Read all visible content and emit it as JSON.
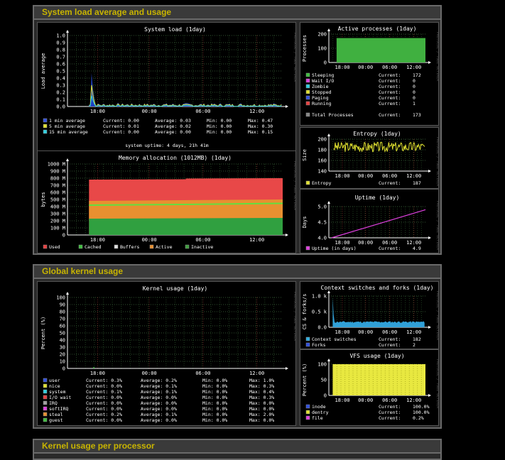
{
  "sections": {
    "load": "System load average and usage",
    "kernel": "Global kernel usage",
    "per_processor": "Kernel usage per processor"
  },
  "watermark": "PROTOCOL / TOBI OETIKER",
  "colors": {
    "bg": "#000000",
    "grid": "#3a5a3a",
    "text": "#ffffff",
    "accent": "#c8b400"
  },
  "charts": {
    "sysload": {
      "title": "System load  (1day)",
      "ylabel": "Load average",
      "xticks": [
        "18:00",
        "00:00",
        "06:00",
        "12:00"
      ],
      "yticks": [
        "1.0",
        "0.9",
        "0.8",
        "0.7",
        "0.6",
        "0.5",
        "0.4",
        "0.3",
        "0.2",
        "0.1",
        "0.0"
      ],
      "legend": [
        {
          "label": "1 min average",
          "cur": "Current:  0.00",
          "avg": "Average:  0.03",
          "min": "Min:  0.00",
          "max": "Max:  0.47",
          "color": "#3050e0"
        },
        {
          "label": "5 min average",
          "cur": "Current:  0.01",
          "avg": "Average:  0.02",
          "min": "Min:  0.00",
          "max": "Max:  0.30",
          "color": "#e0e030"
        },
        {
          "label": "15 min average",
          "cur": "Current:  0.00",
          "avg": "Average:  0.00",
          "min": "Min:  0.00",
          "max": "Max:  0.15",
          "color": "#30d0e0"
        }
      ],
      "footer": "system uptime: 4 days, 21h 41m"
    },
    "memory": {
      "title": "Memory allocation (1012MB)  (1day)",
      "ylabel": "bytes",
      "xticks": [
        "18:00",
        "00:00",
        "06:00",
        "12:00"
      ],
      "yticks": [
        "1000 M",
        "900 M",
        "800 M",
        "700 M",
        "600 M",
        "500 M",
        "400 M",
        "300 M",
        "200 M",
        "100 M",
        "0"
      ],
      "legend": [
        {
          "label": "Used",
          "color": "#e84040"
        },
        {
          "label": "Cached",
          "color": "#40c040"
        },
        {
          "label": "Buffers",
          "color": "#e0e0e0"
        },
        {
          "label": "Active",
          "color": "#e89030"
        },
        {
          "label": "Inactive",
          "color": "#40a040"
        }
      ]
    },
    "procs": {
      "title": "Active processes  (1day)",
      "ylabel": "Processes",
      "xticks": [
        "18:00",
        "00:00",
        "06:00",
        "12:00"
      ],
      "yticks": [
        "200",
        "100",
        "0"
      ],
      "legend": [
        {
          "label": "Sleeping",
          "cur": "Current:",
          "val": "172",
          "color": "#40c040"
        },
        {
          "label": "Wait I/O",
          "cur": "Current:",
          "val": "0",
          "color": "#e040e0"
        },
        {
          "label": "Zombie",
          "cur": "Current:",
          "val": "0",
          "color": "#30d0e0"
        },
        {
          "label": "Stopped",
          "cur": "Current:",
          "val": "0",
          "color": "#e0e030"
        },
        {
          "label": "Paging",
          "cur": "Current:",
          "val": "0",
          "color": "#3050e0"
        },
        {
          "label": "Running",
          "cur": "Current:",
          "val": "1",
          "color": "#e84040"
        }
      ],
      "total": {
        "label": "Total Processes",
        "cur": "Current:",
        "val": "173",
        "color": "#888888"
      }
    },
    "entropy": {
      "title": "Entropy  (1day)",
      "ylabel": "Size",
      "xticks": [
        "18:00",
        "00:00",
        "06:00",
        "12:00"
      ],
      "yticks": [
        "200",
        "180",
        "160",
        "140"
      ],
      "legend": {
        "label": "Entropy",
        "cur": "Current:",
        "val": "187",
        "color": "#e0e030"
      }
    },
    "uptime": {
      "title": "Uptime  (1day)",
      "ylabel": "Days",
      "xticks": [
        "18:00",
        "00:00",
        "06:00",
        "12:00"
      ],
      "yticks": [
        "5.0",
        "4.5",
        "4.0"
      ],
      "legend": {
        "label": "Uptime  (in days)",
        "cur": "Current:",
        "val": "4.9",
        "color": "#e040e0"
      }
    },
    "kernel": {
      "title": "Kernel usage  (1day)",
      "ylabel": "Percent (%)",
      "xticks": [
        "18:00",
        "00:00",
        "06:00",
        "12:00"
      ],
      "yticks": [
        "100",
        "90",
        "80",
        "70",
        "60",
        "50",
        "40",
        "30",
        "20",
        "10",
        "0"
      ],
      "legend": [
        {
          "label": "user",
          "cur": "Current:  0.3%",
          "avg": "Average:  0.2%",
          "min": "Min:  0.0%",
          "max": "Max:  1.0%",
          "color": "#3050e0"
        },
        {
          "label": "nice",
          "cur": "Current:  0.0%",
          "avg": "Average:  0.1%",
          "min": "Min:  0.0%",
          "max": "Max:  0.3%",
          "color": "#e0e030"
        },
        {
          "label": "system",
          "cur": "Current:  0.1%",
          "avg": "Average:  0.1%",
          "min": "Min:  0.0%",
          "max": "Max:  0.4%",
          "color": "#30d0e0"
        },
        {
          "label": "I/O wait",
          "cur": "Current:  0.0%",
          "avg": "Average:  0.0%",
          "min": "Min:  0.0%",
          "max": "Max:  0.3%",
          "color": "#e84040"
        },
        {
          "label": "IRQ",
          "cur": "Current:  0.0%",
          "avg": "Average:  0.0%",
          "min": "Min:  0.0%",
          "max": "Max:  0.0%",
          "color": "#a0a0a0"
        },
        {
          "label": "softIRQ",
          "cur": "Current:  0.0%",
          "avg": "Average:  0.0%",
          "min": "Min:  0.0%",
          "max": "Max:  0.0%",
          "color": "#e040e0"
        },
        {
          "label": "steal",
          "cur": "Current:  0.2%",
          "avg": "Average:  0.1%",
          "min": "Min:  0.0%",
          "max": "Max:  2.0%",
          "color": "#e89030"
        },
        {
          "label": "guest",
          "cur": "Current:  0.0%",
          "avg": "Average:  0.0%",
          "min": "Min:  0.0%",
          "max": "Max:  0.0%",
          "color": "#40c040"
        }
      ]
    },
    "context": {
      "title": "Context switches and forks  (1day)",
      "ylabel": "CS & forks/s",
      "xticks": [
        "18:00",
        "00:00",
        "06:00",
        "12:00"
      ],
      "yticks": [
        "1.0 k",
        "0.5 k",
        "0.0"
      ],
      "legend": [
        {
          "label": "Context switches",
          "cur": "Current:",
          "val": "182",
          "color": "#30b0e0"
        },
        {
          "label": "Forks",
          "cur": "Current:",
          "val": "2",
          "color": "#3050e0"
        }
      ]
    },
    "vfs": {
      "title": "VFS usage  (1day)",
      "ylabel": "Percent (%)",
      "xticks": [
        "18:00",
        "00:00",
        "06:00",
        "12:00"
      ],
      "yticks": [
        "100",
        "50",
        "0"
      ],
      "legend": [
        {
          "label": "inode",
          "cur": "Current:",
          "val": "100.0%",
          "color": "#3050e0"
        },
        {
          "label": "dentry",
          "cur": "Current:",
          "val": "100.0%",
          "color": "#e0e030"
        },
        {
          "label": "file",
          "cur": "Current:",
          "val": "0.2%",
          "color": "#e040e0"
        }
      ]
    }
  },
  "chart_data": [
    {
      "type": "line",
      "title": "System load  (1day)",
      "ylabel": "Load average",
      "ylim": [
        0,
        1.0
      ],
      "series": [
        {
          "name": "1 min average",
          "peak": 0.47
        },
        {
          "name": "5 min average",
          "peak": 0.3
        },
        {
          "name": "15 min average",
          "peak": 0.15
        }
      ]
    },
    {
      "type": "area",
      "title": "Memory allocation (1012MB)  (1day)",
      "ylabel": "bytes",
      "ylim": [
        0,
        1000
      ],
      "series": [
        {
          "name": "Used",
          "values": [
            780,
            780,
            790,
            800
          ]
        },
        {
          "name": "Active",
          "values": [
            410,
            410,
            420,
            430
          ]
        },
        {
          "name": "Inactive",
          "values": [
            200,
            200,
            200,
            210
          ]
        }
      ]
    },
    {
      "type": "area",
      "title": "Active processes  (1day)",
      "ylabel": "Processes",
      "ylim": [
        0,
        200
      ],
      "series": [
        {
          "name": "Sleeping",
          "values": [
            172,
            172,
            172,
            172
          ]
        }
      ]
    },
    {
      "type": "line",
      "title": "Entropy  (1day)",
      "ylabel": "Size",
      "ylim": [
        130,
        200
      ],
      "series": [
        {
          "name": "Entropy",
          "values": [
            180,
            185,
            175,
            187
          ]
        }
      ]
    },
    {
      "type": "line",
      "title": "Uptime  (1day)",
      "ylabel": "Days",
      "ylim": [
        4.0,
        5.0
      ],
      "series": [
        {
          "name": "Uptime  (in days)",
          "values": [
            4.0,
            4.9
          ]
        }
      ]
    },
    {
      "type": "area",
      "title": "Kernel usage  (1day)",
      "ylabel": "Percent (%)",
      "ylim": [
        0,
        100
      ]
    },
    {
      "type": "area",
      "title": "Context switches and forks  (1day)",
      "ylabel": "CS & forks/s",
      "ylim": [
        0,
        1000
      ]
    },
    {
      "type": "area",
      "title": "VFS usage  (1day)",
      "ylabel": "Percent (%)",
      "ylim": [
        0,
        100
      ],
      "series": [
        {
          "name": "dentry",
          "values": [
            100,
            100,
            100,
            100
          ]
        }
      ]
    }
  ]
}
